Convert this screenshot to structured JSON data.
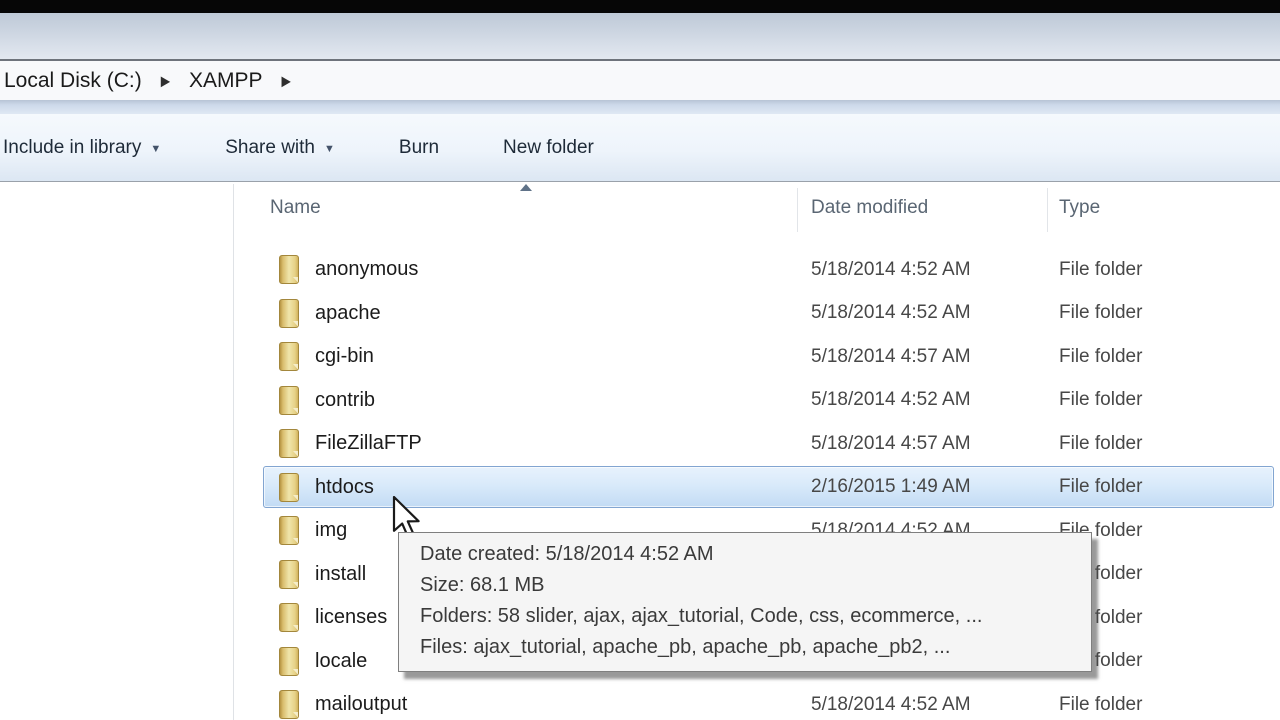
{
  "breadcrumb": {
    "segments": [
      "Local Disk (C:)",
      "XAMPP"
    ]
  },
  "toolbar": {
    "items": [
      {
        "label": "Include in library",
        "has_dropdown": true
      },
      {
        "label": "Share with",
        "has_dropdown": true
      },
      {
        "label": "Burn",
        "has_dropdown": false
      },
      {
        "label": "New folder",
        "has_dropdown": false
      }
    ]
  },
  "columns": {
    "name": "Name",
    "date": "Date modified",
    "type": "Type",
    "sorted_by": "Name",
    "sort_direction": "ascending"
  },
  "files": {
    "rows": [
      {
        "name": "anonymous",
        "date": "5/18/2014 4:52 AM",
        "type": "File folder",
        "selected": false
      },
      {
        "name": "apache",
        "date": "5/18/2014 4:52 AM",
        "type": "File folder",
        "selected": false
      },
      {
        "name": "cgi-bin",
        "date": "5/18/2014 4:57 AM",
        "type": "File folder",
        "selected": false
      },
      {
        "name": "contrib",
        "date": "5/18/2014 4:52 AM",
        "type": "File folder",
        "selected": false
      },
      {
        "name": "FileZillaFTP",
        "date": "5/18/2014 4:57 AM",
        "type": "File folder",
        "selected": false
      },
      {
        "name": "htdocs",
        "date": "2/16/2015 1:49 AM",
        "type": "File folder",
        "selected": true
      },
      {
        "name": "img",
        "date": "5/18/2014 4:52 AM",
        "type": "File folder",
        "selected": false
      },
      {
        "name": "install",
        "date": "",
        "type": "File folder",
        "selected": false
      },
      {
        "name": "licenses",
        "date": "",
        "type": "File folder",
        "selected": false
      },
      {
        "name": "locale",
        "date": "",
        "type": "File folder",
        "selected": false
      },
      {
        "name": "mailoutput",
        "date": "5/18/2014 4:52 AM",
        "type": "File folder",
        "selected": false
      }
    ]
  },
  "tooltip": {
    "lines": [
      "Date created: 5/18/2014 4:52 AM",
      "Size: 68.1 MB",
      "Folders: 58 slider, ajax, ajax_tutorial, Code, css, ecommerce, ...",
      "Files: ajax_tutorial, apache_pb, apache_pb, apache_pb2, ..."
    ]
  },
  "colors": {
    "selection_border": "#82a5d1",
    "selection_fill_top": "#e7f2fd",
    "selection_fill_bottom": "#c2dbf4",
    "folder_gold_dark": "#bd9a43",
    "folder_gold_light": "#f0e5ab",
    "toolbar_text": "#1e2a38"
  }
}
